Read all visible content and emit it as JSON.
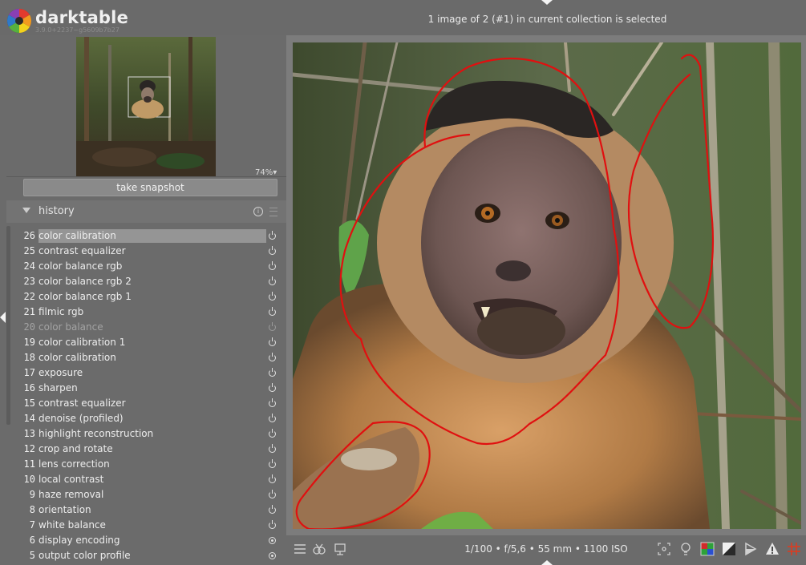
{
  "app": {
    "name": "darktable",
    "version": "3.9.0+2237~g5609b7b27"
  },
  "status": {
    "title": "1 image of 2 (#1) in current collection is selected"
  },
  "navigator": {
    "zoom": "74%"
  },
  "snapshots": {
    "button_label": "take snapshot"
  },
  "history": {
    "title": "history",
    "items": [
      {
        "num": "26",
        "name": "color calibration",
        "state": "active"
      },
      {
        "num": "25",
        "name": "contrast equalizer",
        "state": "on"
      },
      {
        "num": "24",
        "name": "color balance rgb",
        "state": "on"
      },
      {
        "num": "23",
        "name": "color balance rgb 2",
        "state": "on"
      },
      {
        "num": "22",
        "name": "color balance rgb 1",
        "state": "on"
      },
      {
        "num": "21",
        "name": "filmic rgb",
        "state": "on"
      },
      {
        "num": "20",
        "name": "color balance",
        "state": "off"
      },
      {
        "num": "19",
        "name": "color calibration 1",
        "state": "on"
      },
      {
        "num": "18",
        "name": "color calibration",
        "state": "on"
      },
      {
        "num": "17",
        "name": "exposure",
        "state": "on"
      },
      {
        "num": "16",
        "name": "sharpen",
        "state": "on"
      },
      {
        "num": "15",
        "name": "contrast equalizer",
        "state": "on"
      },
      {
        "num": "14",
        "name": "denoise (profiled)",
        "state": "on"
      },
      {
        "num": "13",
        "name": "highlight reconstruction",
        "state": "on"
      },
      {
        "num": "12",
        "name": "crop and rotate",
        "state": "on"
      },
      {
        "num": "11",
        "name": "lens correction",
        "state": "on"
      },
      {
        "num": "10",
        "name": "local contrast",
        "state": "on"
      },
      {
        "num": "9",
        "name": "haze removal",
        "state": "on"
      },
      {
        "num": "8",
        "name": "orientation",
        "state": "on"
      },
      {
        "num": "7",
        "name": "white balance",
        "state": "on"
      },
      {
        "num": "6",
        "name": "display encoding",
        "state": "always"
      },
      {
        "num": "5",
        "name": "output color profile",
        "state": "always"
      }
    ]
  },
  "bottombar": {
    "exif": "1/100 • f/5,6 • 55 mm • 1100 ISO"
  },
  "colors": {
    "annotation": "#e01010",
    "panel": "#6b6b6b",
    "center": "#7c7c7c"
  }
}
